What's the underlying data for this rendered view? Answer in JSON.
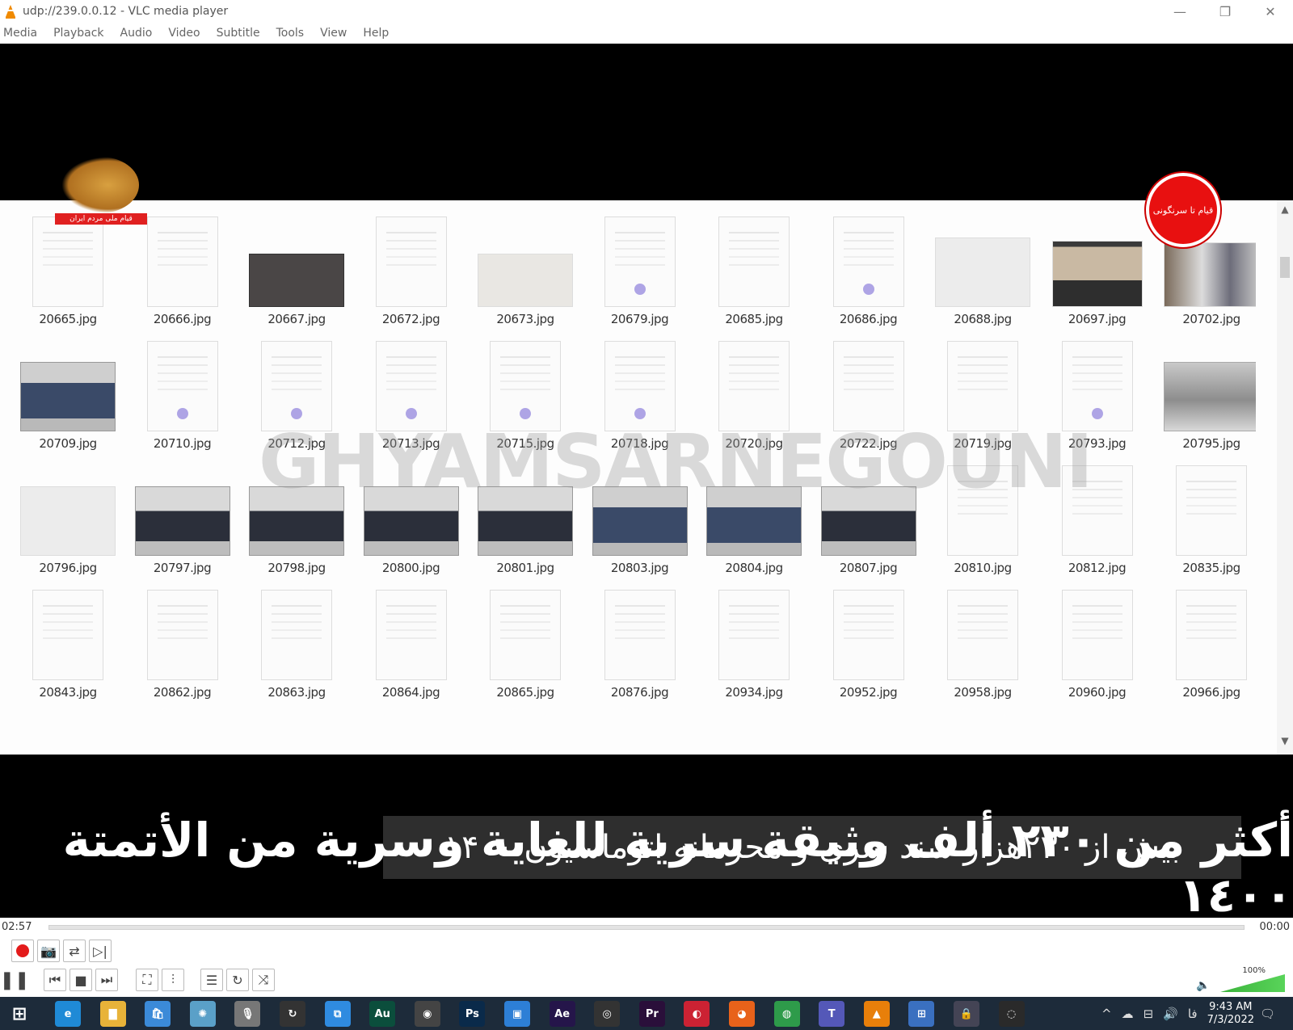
{
  "window": {
    "title": "udp://239.0.0.12 - VLC media player",
    "controls": {
      "minimize": "—",
      "restore": "❐",
      "close": "✕"
    }
  },
  "menu": [
    "Media",
    "Playback",
    "Audio",
    "Video",
    "Subtitle",
    "Tools",
    "View",
    "Help"
  ],
  "video": {
    "watermark": "GHYAMSARNEGOUNI",
    "caption_fa": "بیش از ۲۳۰هزار سند سری و محرمانه اتوماسیون ۱۴۰۰",
    "caption_ar": "أكثر من ٢٣٠ ألف وثيقة سرية للغاية وسرية من الأتمتة ١٤٠٠",
    "logo_left_banner": "قیام ملی مردم ایران",
    "logo_right_text": "قیام تا سرنگونی",
    "files": [
      [
        "20665.jpg",
        "20666.jpg",
        "20667.jpg",
        "20672.jpg",
        "20673.jpg",
        "20679.jpg",
        "20685.jpg",
        "20686.jpg",
        "20688.jpg",
        "20697.jpg",
        "20702.jpg"
      ],
      [
        "20709.jpg",
        "20710.jpg",
        "20712.jpg",
        "20713.jpg",
        "20715.jpg",
        "20718.jpg",
        "20720.jpg",
        "20722.jpg",
        "20719.jpg",
        "20793.jpg",
        "20795.jpg"
      ],
      [
        "20796.jpg",
        "20797.jpg",
        "20798.jpg",
        "20800.jpg",
        "20801.jpg",
        "20803.jpg",
        "20804.jpg",
        "20807.jpg",
        "20810.jpg",
        "20812.jpg",
        "20835.jpg"
      ],
      [
        "20843.jpg",
        "20862.jpg",
        "20863.jpg",
        "20864.jpg",
        "20865.jpg",
        "20876.jpg",
        "20934.jpg",
        "20952.jpg",
        "20958.jpg",
        "20960.jpg",
        "20966.jpg"
      ]
    ],
    "thumb_types": [
      [
        "doc",
        "doc",
        "dark",
        "doc",
        "paper",
        "doc stamp",
        "doc",
        "doc stamp",
        "pale",
        "video1",
        "people"
      ],
      [
        "car blue",
        "doc stamp",
        "doc stamp",
        "doc stamp",
        "doc stamp",
        "doc stamp",
        "doc",
        "doc",
        "doc",
        "doc stamp",
        "photo"
      ],
      [
        "pale",
        "car",
        "car",
        "car",
        "car",
        "car blue",
        "car blue",
        "car",
        "doc",
        "doc",
        "doc"
      ],
      [
        "doc",
        "doc",
        "doc",
        "doc",
        "doc",
        "doc",
        "doc",
        "doc",
        "doc",
        "doc",
        "doc"
      ]
    ]
  },
  "playback": {
    "elapsed": "02:57",
    "remaining": "00:00",
    "volume": "100%",
    "volume_level": 1.0
  },
  "taskbar": {
    "time": "9:43 AM",
    "date": "7/3/2022",
    "lang": "فا",
    "apps": [
      {
        "name": "edge-icon",
        "glyph": "e",
        "color": "#1f8ad6"
      },
      {
        "name": "explorer-icon",
        "glyph": "▇",
        "color": "#e8b339"
      },
      {
        "name": "store-icon",
        "glyph": "🛍",
        "color": "#3b8ad8"
      },
      {
        "name": "app-bird-icon",
        "glyph": "✺",
        "color": "#5aa0c8"
      },
      {
        "name": "mic-icon",
        "glyph": "🎙",
        "color": "#777"
      },
      {
        "name": "spinner-icon",
        "glyph": "↻",
        "color": "#333"
      },
      {
        "name": "remote-desktop-icon",
        "glyph": "⧉",
        "color": "#2f8be0"
      },
      {
        "name": "audition-icon",
        "glyph": "Au",
        "color": "#0b4e3c"
      },
      {
        "name": "davinci-icon",
        "glyph": "◉",
        "color": "#444"
      },
      {
        "name": "photoshop-icon",
        "glyph": "Ps",
        "color": "#0a2a4a"
      },
      {
        "name": "display-icon",
        "glyph": "▣",
        "color": "#2d7fd6"
      },
      {
        "name": "after-effects-icon",
        "glyph": "Ae",
        "color": "#25154a"
      },
      {
        "name": "obs-icon",
        "glyph": "◎",
        "color": "#333"
      },
      {
        "name": "premiere-icon",
        "glyph": "Pr",
        "color": "#2a0f3a"
      },
      {
        "name": "chrome-like-icon",
        "glyph": "◐",
        "color": "#c23"
      },
      {
        "name": "firefox-icon",
        "glyph": "◕",
        "color": "#e8621a"
      },
      {
        "name": "chrome-icon",
        "glyph": "◍",
        "color": "#2e9b4a"
      },
      {
        "name": "teams-icon",
        "glyph": "T",
        "color": "#5458b8"
      },
      {
        "name": "vlc-icon",
        "glyph": "▲",
        "color": "#e87f0a"
      },
      {
        "name": "network-app-icon",
        "glyph": "⊞",
        "color": "#3a70c0"
      },
      {
        "name": "vpn-icon",
        "glyph": "🔒",
        "color": "#445"
      },
      {
        "name": "obs-studio-icon",
        "glyph": "◌",
        "color": "#2a2a2a"
      }
    ]
  }
}
